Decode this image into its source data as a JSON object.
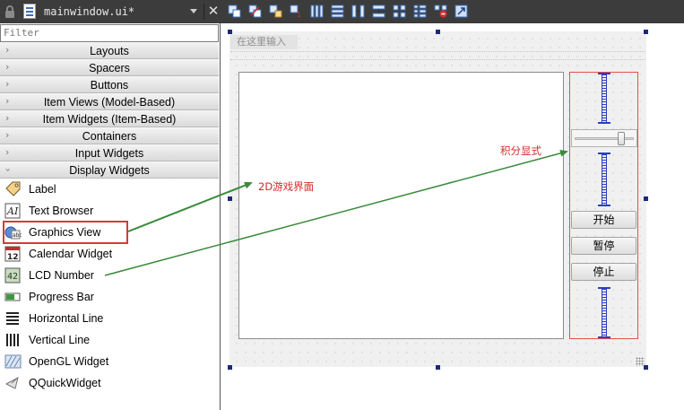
{
  "toolbar": {
    "file_title": "mainwindow.ui*",
    "tools": [
      "edit-widgets-icon",
      "edit-signals-icon",
      "edit-buddies-icon",
      "edit-taborder-icon",
      "layout-horizontal-icon",
      "layout-vertical-icon",
      "layout-hsplitter-icon",
      "layout-vsplitter-icon",
      "layout-grid-icon",
      "layout-form-icon",
      "break-layout-icon",
      "adjust-size-icon"
    ]
  },
  "widgetbox": {
    "filter_placeholder": "Filter",
    "categories": [
      {
        "label": "Layouts",
        "expanded": false
      },
      {
        "label": "Spacers",
        "expanded": false
      },
      {
        "label": "Buttons",
        "expanded": false
      },
      {
        "label": "Item Views (Model-Based)",
        "expanded": false
      },
      {
        "label": "Item Widgets (Item-Based)",
        "expanded": false
      },
      {
        "label": "Containers",
        "expanded": false
      },
      {
        "label": "Input Widgets",
        "expanded": false
      },
      {
        "label": "Display Widgets",
        "expanded": true
      }
    ],
    "display_widgets": [
      {
        "label": "Label",
        "icon": "label-icon"
      },
      {
        "label": "Text Browser",
        "icon": "text-browser-icon"
      },
      {
        "label": "Graphics View",
        "icon": "graphics-view-icon"
      },
      {
        "label": "Calendar Widget",
        "icon": "calendar-icon"
      },
      {
        "label": "LCD Number",
        "icon": "lcd-number-icon"
      },
      {
        "label": "Progress Bar",
        "icon": "progress-bar-icon"
      },
      {
        "label": "Horizontal Line",
        "icon": "horizontal-line-icon"
      },
      {
        "label": "Vertical Line",
        "icon": "vertical-line-icon"
      },
      {
        "label": "OpenGL Widget",
        "icon": "opengl-icon"
      },
      {
        "label": "QQuickWidget",
        "icon": "qquickwidget-icon"
      }
    ],
    "calendar_icon_text": "12",
    "lcd_icon_text": "42"
  },
  "form": {
    "menu_placeholder": "在这里输入",
    "buttons": {
      "start": "开始",
      "pause": "暂停",
      "stop": "停止"
    },
    "slider_value": 0.82
  },
  "annotations": {
    "game_area": "2D游戏界面",
    "score": "积分显式"
  },
  "colors": {
    "toolbar_bg": "#3c3c3c",
    "highlight": "#d63a3a",
    "arrow": "#3a8a3a",
    "handle": "#1a2a78",
    "spacer": "#2a3fbf"
  }
}
